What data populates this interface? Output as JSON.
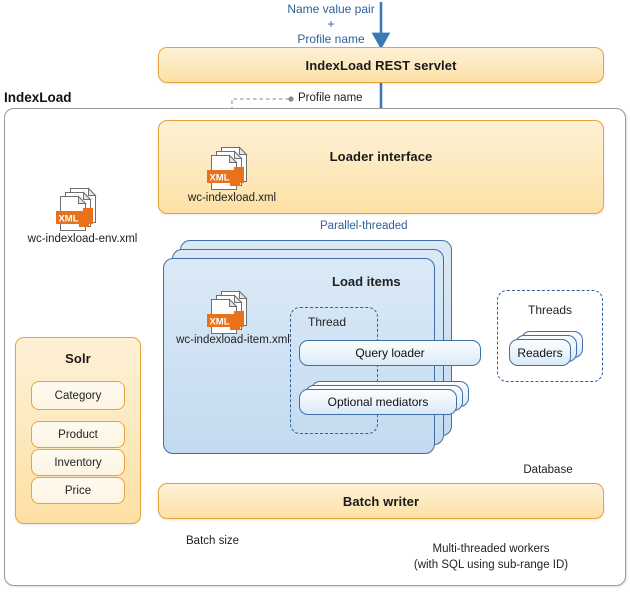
{
  "diagram": {
    "title": "IndexLoad",
    "top_annotation": {
      "line1": "Name value pair",
      "line2": "+",
      "line3": "Profile name"
    },
    "rest_servlet": "IndexLoad REST servlet",
    "profile_name_label": "Profile name",
    "loader_interface": "Loader interface",
    "parallel_threaded_label": "Parallel-threaded",
    "files": {
      "env_xml": "wc-indexload-env.xml",
      "loader_xml": "wc-indexload.xml",
      "item_xml": "wc-indexload-item.xml",
      "icon_text": "XML"
    },
    "load_items": {
      "title": "Load items",
      "thread_label": "Thread",
      "query_loader": "Query loader",
      "optional_mediators": "Optional mediators"
    },
    "threads_group": {
      "title": "Threads",
      "readers": "Readers"
    },
    "database_label": "Database",
    "batch_writer": "Batch writer",
    "batch_size_label": "Batch size",
    "workers_note": {
      "line1": "Multi-threaded workers",
      "line2": "(with SQL using sub-range ID)"
    },
    "solr": {
      "title": "Solr",
      "items": [
        "Category",
        "Product",
        "Inventory",
        "Price"
      ]
    },
    "colors": {
      "orange_border": "#e8a33d",
      "orange_fill": "#fde0a4",
      "blue_border": "#3f6fa8",
      "blue_fill": "#cfe2f3",
      "arrow_blue": "#3b7ab5",
      "text_blue": "#2e6099",
      "gray_line": "#8a8a8a",
      "xml_orange": "#e8711a"
    }
  }
}
